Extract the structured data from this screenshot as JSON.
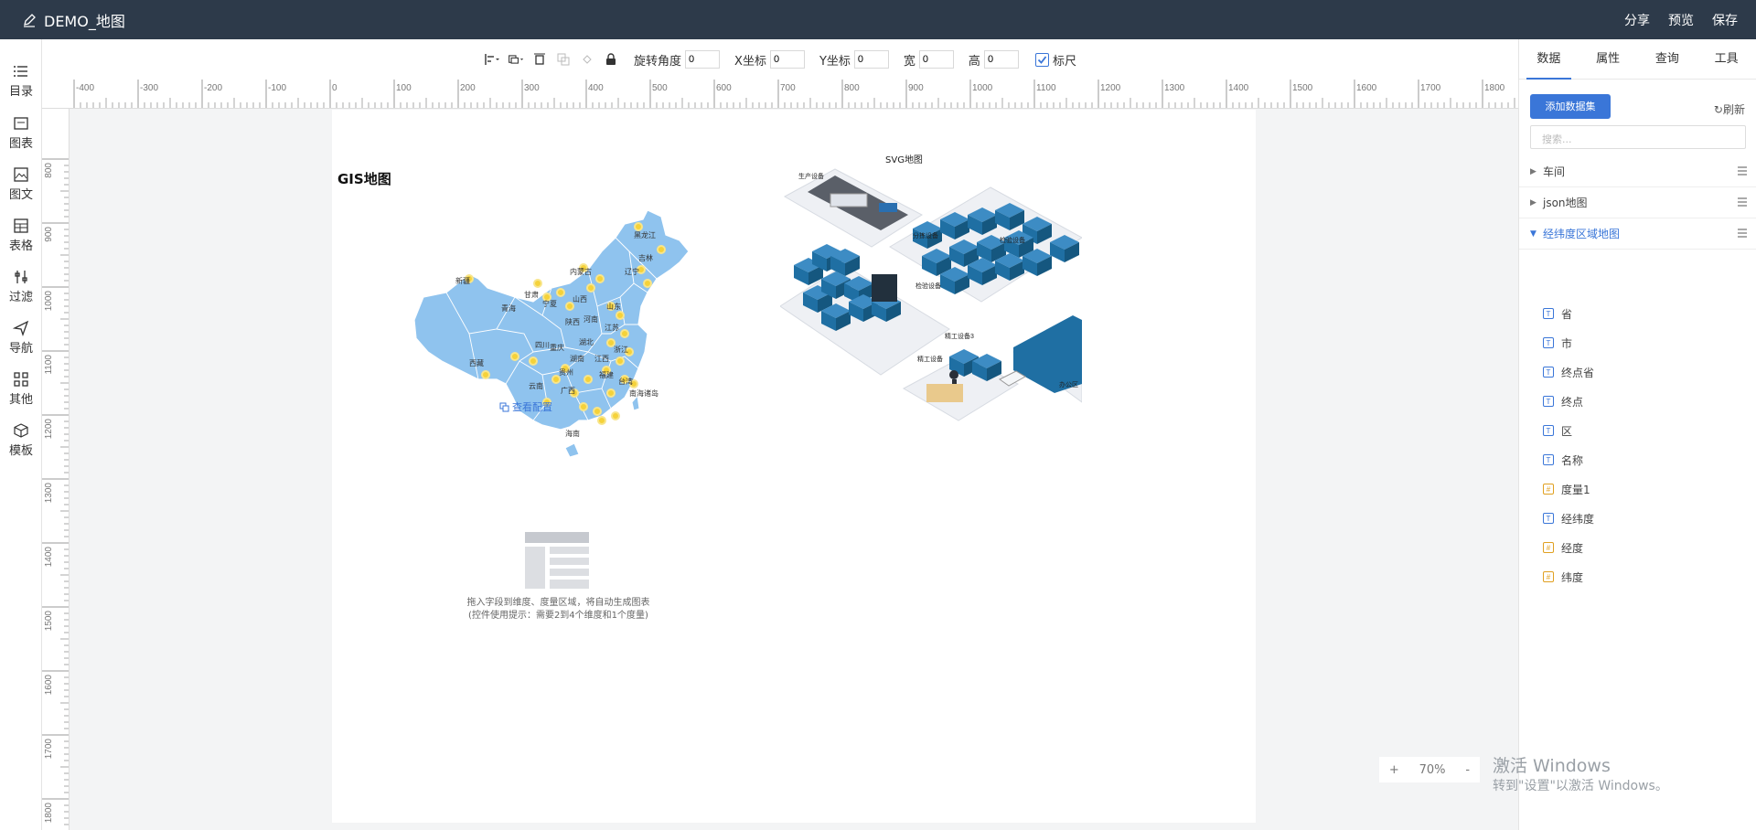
{
  "app": {
    "title": "DEMO_地图",
    "actions": [
      "分享",
      "预览",
      "保存"
    ]
  },
  "leftnav": [
    {
      "label": "目录",
      "icon": "list-icon"
    },
    {
      "label": "图表",
      "icon": "chart-icon"
    },
    {
      "label": "图文",
      "icon": "image-text-icon"
    },
    {
      "label": "表格",
      "icon": "table-icon"
    },
    {
      "label": "过滤",
      "icon": "filter-icon"
    },
    {
      "label": "导航",
      "icon": "navigate-icon"
    },
    {
      "label": "其他",
      "icon": "grid-icon"
    },
    {
      "label": "模板",
      "icon": "cube-icon"
    }
  ],
  "toolbar": {
    "rotate_label": "旋转角度",
    "rotate_value": "0",
    "x_label": "X坐标",
    "x_value": "0",
    "y_label": "Y坐标",
    "y_value": "0",
    "w_label": "宽",
    "w_value": "0",
    "h_label": "高",
    "h_value": "0",
    "ruler_label": "标尺",
    "ruler_checked": true
  },
  "ruler": {
    "h_ticks": [
      "-400",
      "-300",
      "-200",
      "-100",
      "0",
      "100",
      "200",
      "300",
      "400",
      "500",
      "600",
      "700",
      "800",
      "900",
      "1000",
      "1100",
      "1200",
      "1300",
      "1400",
      "1500",
      "1600",
      "1700",
      "1800"
    ],
    "v_ticks": [
      "800",
      "900",
      "1000",
      "1100",
      "1200",
      "1300",
      "1400",
      "1500",
      "1600",
      "1700",
      "1800"
    ]
  },
  "canvas": {
    "gis_title": "GIS地图",
    "view_config": "查看配置",
    "svg_title": "SVG地图",
    "placeholder_line1": "拖入字段到维度、度量区域，将自动生成图表",
    "placeholder_line2": "(控件使用提示：需要2到4个维度和1个度量)",
    "map_labels": [
      "新疆",
      "西藏",
      "青海",
      "甘肃",
      "内蒙古",
      "黑龙江",
      "吉林",
      "辽宁",
      "宁夏",
      "陕西",
      "山西",
      "山东",
      "河南",
      "江苏",
      "四川",
      "重庆",
      "湖北",
      "浙江",
      "湖南",
      "江西",
      "贵州",
      "云南",
      "广西",
      "福建",
      "台湾",
      "海南",
      "南海诸岛"
    ],
    "svg_labels": [
      "生产设备",
      "分拣设备",
      "检验设备",
      "检验设备",
      "办公区",
      "精工设备3",
      "精工设备"
    ]
  },
  "rightpanel": {
    "tabs": [
      "数据",
      "属性",
      "查询",
      "工具"
    ],
    "active_tab": "数据",
    "add_dataset": "添加数据集",
    "refresh": "刷新",
    "search_placeholder": "搜索...",
    "datasets": [
      {
        "name": "车间",
        "expanded": false
      },
      {
        "name": "json地图",
        "expanded": false
      },
      {
        "name": "经纬度区域地图",
        "expanded": true
      }
    ],
    "fields": [
      {
        "name": "省",
        "type": "dimension"
      },
      {
        "name": "市",
        "type": "dimension"
      },
      {
        "name": "终点省",
        "type": "dimension"
      },
      {
        "name": "终点",
        "type": "dimension"
      },
      {
        "name": "区",
        "type": "dimension"
      },
      {
        "name": "名称",
        "type": "dimension"
      },
      {
        "name": "度量1",
        "type": "measure"
      },
      {
        "name": "经纬度",
        "type": "dimension"
      },
      {
        "name": "经度",
        "type": "measure"
      },
      {
        "name": "纬度",
        "type": "measure"
      }
    ]
  },
  "zoom": {
    "value": "70%"
  },
  "watermark": {
    "line1": "激活 Windows",
    "line2": "转到\"设置\"以激活 Windows。"
  },
  "colors": {
    "topbar": "#2d3a4a",
    "accent": "#3a76d8",
    "map_fill": "#8fc3ee",
    "marker": "#f5d23a",
    "machine": "#1f6fa3"
  }
}
